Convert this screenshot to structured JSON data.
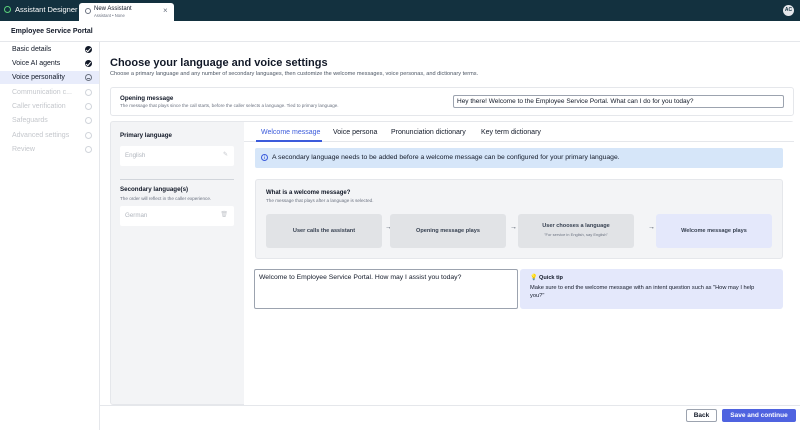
{
  "app": {
    "name": "Assistant Designer",
    "tab_title": "New Assistant",
    "tab_subtitle": "Assistant • None",
    "tab_close": "×",
    "user_initials": "AC"
  },
  "portal_title": "Employee Service Portal",
  "sidebar": {
    "items": [
      {
        "label": "Basic details",
        "status": "done"
      },
      {
        "label": "Voice AI agents",
        "status": "done"
      },
      {
        "label": "Voice personality",
        "status": "current"
      },
      {
        "label": "Communication c...",
        "status": "pending"
      },
      {
        "label": "Caller verification",
        "status": "pending"
      },
      {
        "label": "Safeguards",
        "status": "pending"
      },
      {
        "label": "Advanced settings",
        "status": "pending"
      },
      {
        "label": "Review",
        "status": "pending"
      }
    ]
  },
  "main": {
    "title": "Choose your language and voice settings",
    "subtitle": "Choose a primary language and any number of secondary languages, then customize the welcome messages, voice personas, and dictionary terms."
  },
  "opening": {
    "label": "Opening message",
    "hint": "The message that plays since the call starts, before the caller selects a language. Tied to primary language.",
    "value": "Hey there! Welcome to the Employee Service Portal. What can I do for you today?"
  },
  "languages": {
    "primary_label": "Primary language",
    "primary_value": "English",
    "secondary_label": "Secondary language(s)",
    "secondary_hint": "The order will reflect in the caller experience.",
    "secondary_value": "German"
  },
  "tabs": {
    "welcome": "Welcome message",
    "persona": "Voice persona",
    "pronunciation": "Pronunciation dictionary",
    "keyterm": "Key term dictionary"
  },
  "info": {
    "icon": "i",
    "text": "A secondary language needs to be added before a welcome message can be configured for your primary language."
  },
  "what": {
    "title": "What is a welcome message?",
    "hint": "The message that plays after a language is selected.",
    "steps": [
      {
        "label": "User calls the assistant",
        "sub": ""
      },
      {
        "label": "Opening message plays",
        "sub": ""
      },
      {
        "label": "User chooses a language",
        "sub": "\"For service in English, say English\""
      },
      {
        "label": "Welcome message plays",
        "sub": ""
      }
    ],
    "arrow": "→"
  },
  "welcome_message": "Welcome to Employee Service Portal. How may I assist you today?",
  "tip": {
    "title": "Quick tip",
    "text": "Make sure to end the welcome message with an intent question such as \"How may I help you?\""
  },
  "footer": {
    "back": "Back",
    "save": "Save and continue"
  },
  "colors": {
    "topbar": "#13313f",
    "accent": "#4f63e0",
    "info_bg": "#d6e6f9",
    "tip_bg": "#e4e8fb"
  }
}
